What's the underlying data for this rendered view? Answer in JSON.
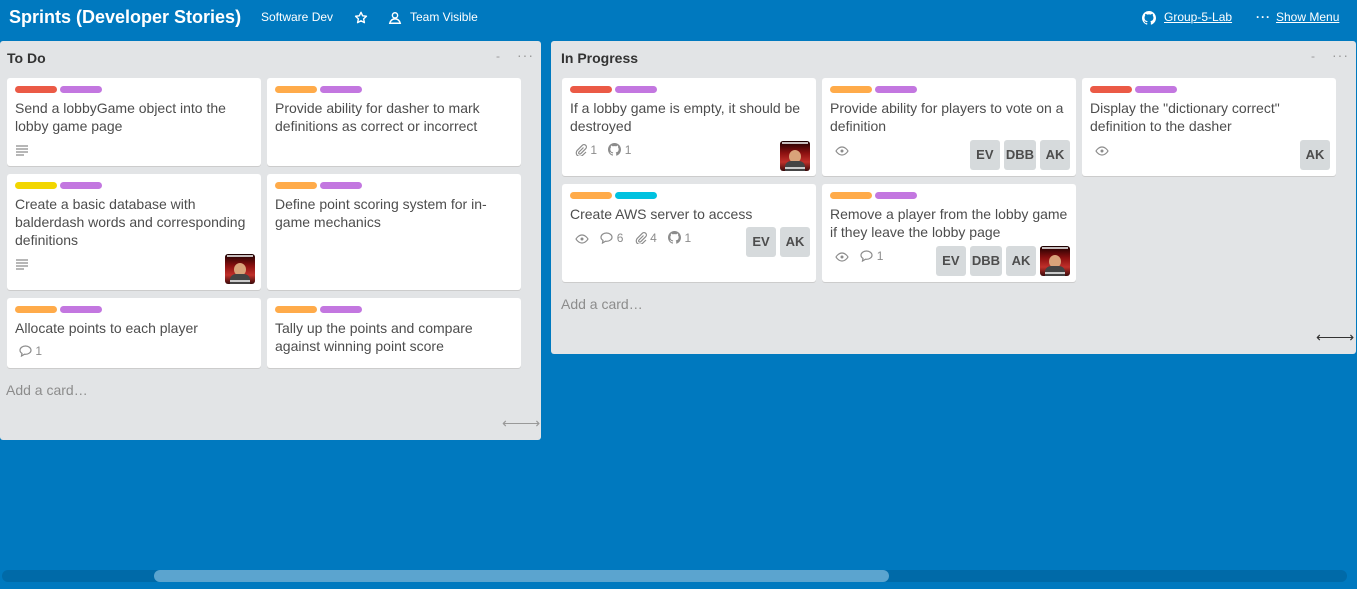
{
  "colors": {
    "background": "#0079bf",
    "list_bg": "#e2e4e6",
    "label_red": "#eb5a46",
    "label_purple": "#c377e0",
    "label_orange": "#ffab4a",
    "label_yellow": "#f2d600",
    "label_sky": "#00c2e0"
  },
  "header": {
    "board_title": "Sprints (Developer Stories)",
    "team": "Software Dev",
    "star_icon": "star-icon",
    "visibility": "Team Visible",
    "github_link": "Group-5-Lab",
    "show_menu": "Show Menu"
  },
  "lists": [
    {
      "title": "To Do",
      "minimize": "-",
      "menu": "···",
      "add_card": "Add a card…",
      "scroll_arrows": "⟵⟶",
      "cards": [
        {
          "labels": [
            "red",
            "purple"
          ],
          "title": "Send a lobbyGame object into the lobby game page",
          "badges": {
            "description": true
          }
        },
        {
          "labels": [
            "orange",
            "purple"
          ],
          "title": "Provide ability for dasher to mark definitions as correct or incorrect"
        },
        {
          "labels": [
            "yellow",
            "purple"
          ],
          "title": "Create a basic database with balderdash words and corresponding definitions",
          "badges": {
            "description": true
          },
          "avatar": true
        },
        {
          "labels": [
            "orange",
            "purple"
          ],
          "title": "Define point scoring system for in-game mechanics"
        },
        {
          "labels": [
            "orange",
            "purple"
          ],
          "title": "Allocate points to each player",
          "badges": {
            "comments": "1"
          }
        },
        {
          "labels": [
            "orange",
            "purple"
          ],
          "title": "Tally up the points and compare against winning point score"
        }
      ]
    },
    {
      "title": "In Progress",
      "minimize": "-",
      "menu": "···",
      "add_card": "Add a card…",
      "scroll_arrows": "⟵⟶",
      "cards": [
        {
          "labels": [
            "red",
            "purple"
          ],
          "title": "If a lobby game is empty, it should be destroyed",
          "badges": {
            "attachments": "1",
            "github": "1"
          },
          "avatar": true
        },
        {
          "labels": [
            "orange",
            "purple"
          ],
          "title": "Provide ability for players to vote on a definition",
          "badges": {
            "watching": true
          },
          "members": [
            "EV",
            "DBB",
            "AK"
          ]
        },
        {
          "labels": [
            "red",
            "purple"
          ],
          "title": "Display the \"dictionary correct\" definition to the dasher",
          "badges": {
            "watching": true
          },
          "members": [
            "AK"
          ]
        },
        {
          "labels": [
            "orange",
            "sky"
          ],
          "title": "Create AWS server to access",
          "badges": {
            "watching": true,
            "comments": "6",
            "attachments": "4",
            "github": "1"
          },
          "members": [
            "EV",
            "AK"
          ]
        },
        {
          "labels": [
            "orange",
            "purple"
          ],
          "title": "Remove a player from the lobby game if they leave the lobby page",
          "badges": {
            "watching": true,
            "comments": "1"
          },
          "members": [
            "EV",
            "DBB",
            "AK"
          ],
          "avatar": true
        }
      ]
    }
  ],
  "scrollbar": {
    "label": "horizontal-scrollbar"
  }
}
